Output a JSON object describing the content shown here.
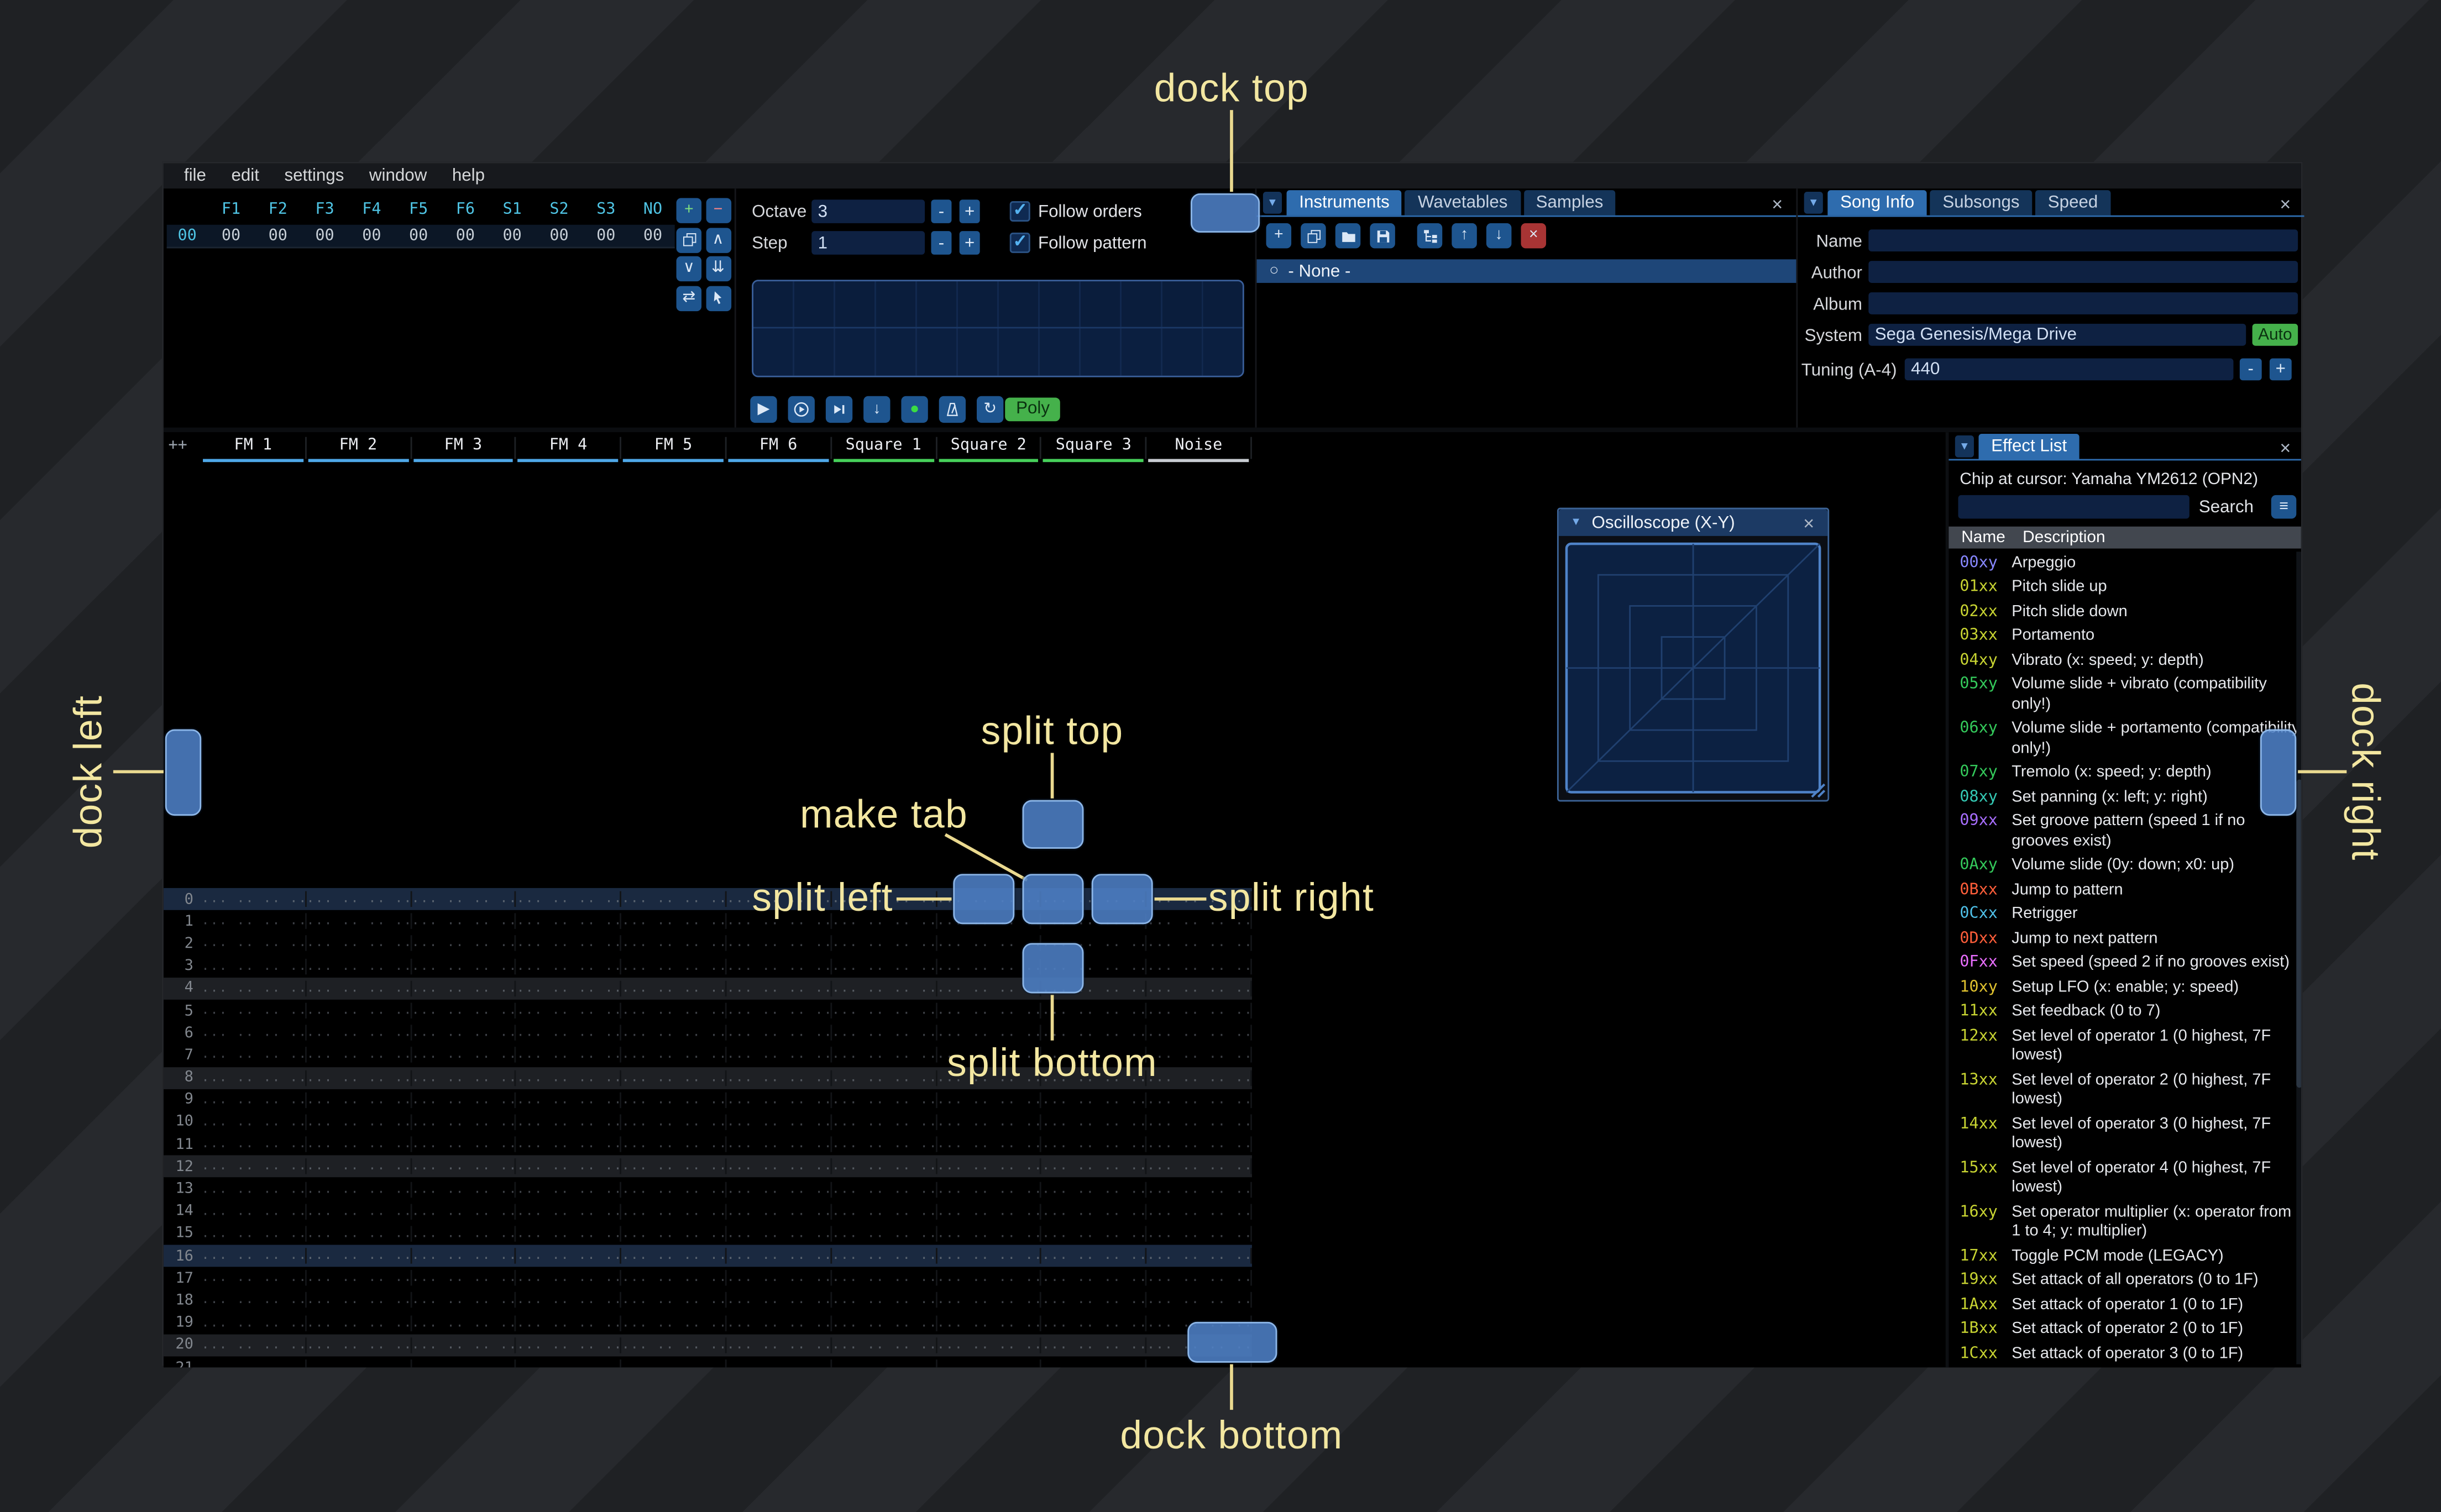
{
  "window": {
    "menu_items": [
      "file",
      "edit",
      "settings",
      "window",
      "help"
    ]
  },
  "orders": {
    "row_index": "00",
    "channel_headers": [
      "F1",
      "F2",
      "F3",
      "F4",
      "F5",
      "F6",
      "S1",
      "S2",
      "S3",
      "NO"
    ],
    "cells": [
      "00",
      "00",
      "00",
      "00",
      "00",
      "00",
      "00",
      "00",
      "00",
      "00"
    ],
    "buttons": [
      {
        "name": "add-order-button",
        "icon": "plus",
        "color": "#7fe07f"
      },
      {
        "name": "remove-order-button",
        "icon": "minus",
        "color": "#ff8585"
      },
      {
        "name": "duplicate-order-button",
        "icon": "duplicate"
      },
      {
        "name": "move-order-up-button",
        "icon": "chevron-up"
      },
      {
        "name": "move-order-down-button",
        "icon": "chevron-down"
      },
      {
        "name": "order-add-at-end-button",
        "icon": "chevrons-down"
      },
      {
        "name": "order-change-mode-button",
        "icon": "swap"
      },
      {
        "name": "order-edit-mode-button",
        "icon": "pointer"
      }
    ]
  },
  "controls": {
    "octave": {
      "label": "Octave",
      "value": "3"
    },
    "step": {
      "label": "Step",
      "value": "1"
    },
    "spin_minus": "-",
    "spin_plus": "+",
    "follow_orders": {
      "label": "Follow orders",
      "checked": true
    },
    "follow_pattern": {
      "label": "Follow pattern",
      "checked": true
    },
    "transport": [
      {
        "name": "play-button",
        "icon": "play"
      },
      {
        "name": "play-pattern-button",
        "icon": "play-pattern"
      },
      {
        "name": "play-from-cursor-button",
        "icon": "play-row"
      },
      {
        "name": "step-one-row-button",
        "icon": "step-down"
      },
      {
        "name": "record-button",
        "icon": "record",
        "color": "#3bdc43"
      },
      {
        "name": "metronome-button",
        "icon": "metronome"
      },
      {
        "name": "repeat-pattern-button",
        "icon": "repeat"
      }
    ],
    "poly_label": "Poly"
  },
  "instruments": {
    "tabs": [
      {
        "label": "Instruments",
        "selected": true
      },
      {
        "label": "Wavetables",
        "selected": false
      },
      {
        "label": "Samples",
        "selected": false
      }
    ],
    "toolbar": [
      {
        "name": "add-instrument-button",
        "icon": "plus"
      },
      {
        "name": "duplicate-instrument-button",
        "icon": "duplicate"
      },
      {
        "name": "open-instrument-button",
        "icon": "folder-open"
      },
      {
        "name": "save-instrument-button",
        "icon": "save"
      },
      {
        "name": "instrument-folder-view-button",
        "icon": "tree",
        "gap": true
      },
      {
        "name": "move-instrument-up-button",
        "icon": "arrow-up"
      },
      {
        "name": "move-instrument-down-button",
        "icon": "arrow-down"
      },
      {
        "name": "delete-instrument-button",
        "icon": "close",
        "bg": "#a83434"
      }
    ],
    "list": [
      {
        "label": "- None -",
        "selected": true
      }
    ]
  },
  "song_info": {
    "tabs": [
      {
        "label": "Song Info",
        "selected": true
      },
      {
        "label": "Subsongs",
        "selected": false
      },
      {
        "label": "Speed",
        "selected": false
      }
    ],
    "fields": [
      {
        "label": "Name",
        "value": ""
      },
      {
        "label": "Author",
        "value": ""
      },
      {
        "label": "Album",
        "value": ""
      }
    ],
    "system": {
      "label": "System",
      "value": "Sega Genesis/Mega Drive",
      "auto_label": "Auto"
    },
    "tuning": {
      "label": "Tuning (A-4)",
      "value": "440",
      "minus": "-",
      "plus": "+"
    }
  },
  "pattern": {
    "corner_label": "++",
    "channels": [
      {
        "name": "FM 1",
        "color": "#4fa8e8"
      },
      {
        "name": "FM 2",
        "color": "#4fa8e8"
      },
      {
        "name": "FM 3",
        "color": "#4fa8e8"
      },
      {
        "name": "FM 4",
        "color": "#4fa8e8"
      },
      {
        "name": "FM 5",
        "color": "#4fa8e8"
      },
      {
        "name": "FM 6",
        "color": "#4fa8e8"
      },
      {
        "name": "Square 1",
        "color": "#46d05a"
      },
      {
        "name": "Square 2",
        "color": "#46d05a"
      },
      {
        "name": "Square 3",
        "color": "#46d05a"
      },
      {
        "name": "Noise",
        "color": "#c8ccd2"
      }
    ],
    "row_count": 22,
    "empty_cell": "... .. .. ...."
  },
  "effect_list": {
    "tab": "Effect List",
    "chip_line": "Chip at cursor: Yamaha YM2612 (OPN2)",
    "search_label": "Search",
    "header_name": "Name",
    "header_desc": "Description",
    "effects": [
      {
        "code": "00xy",
        "desc": "Arpeggio",
        "color": "#8787ff"
      },
      {
        "code": "01xx",
        "desc": "Pitch slide up",
        "color": "#c8d432"
      },
      {
        "code": "02xx",
        "desc": "Pitch slide down",
        "color": "#c8d432"
      },
      {
        "code": "03xx",
        "desc": "Portamento",
        "color": "#c8d432"
      },
      {
        "code": "04xy",
        "desc": "Vibrato (x: speed; y: depth)",
        "color": "#c8d432"
      },
      {
        "code": "05xy",
        "desc": "Volume slide + vibrato (compatibility only!)",
        "color": "#34c95b"
      },
      {
        "code": "06xy",
        "desc": "Volume slide + portamento (compatibility only!)",
        "color": "#34c95b"
      },
      {
        "code": "07xy",
        "desc": "Tremolo (x: speed; y: depth)",
        "color": "#34c95b"
      },
      {
        "code": "08xy",
        "desc": "Set panning (x: left; y: right)",
        "color": "#34c9b4"
      },
      {
        "code": "09xx",
        "desc": "Set groove pattern (speed 1 if no grooves exist)",
        "color": "#a86eff"
      },
      {
        "code": "0Axy",
        "desc": "Volume slide (0y: down; x0: up)",
        "color": "#34c95b"
      },
      {
        "code": "0Bxx",
        "desc": "Jump to pattern",
        "color": "#ff5e3a"
      },
      {
        "code": "0Cxx",
        "desc": "Retrigger",
        "color": "#4fc0e8"
      },
      {
        "code": "0Dxx",
        "desc": "Jump to next pattern",
        "color": "#ff5e3a"
      },
      {
        "code": "0Fxx",
        "desc": "Set speed (speed 2 if no grooves exist)",
        "color": "#e96eff"
      },
      {
        "code": "10xy",
        "desc": "Setup LFO (x: enable; y: speed)",
        "color": "#e0c22f"
      },
      {
        "code": "11xx",
        "desc": "Set feedback (0 to 7)",
        "color": "#c8d432"
      },
      {
        "code": "12xx",
        "desc": "Set level of operator 1 (0 highest, 7F lowest)",
        "color": "#c8d432"
      },
      {
        "code": "13xx",
        "desc": "Set level of operator 2 (0 highest, 7F lowest)",
        "color": "#c8d432"
      },
      {
        "code": "14xx",
        "desc": "Set level of operator 3 (0 highest, 7F lowest)",
        "color": "#c8d432"
      },
      {
        "code": "15xx",
        "desc": "Set level of operator 4 (0 highest, 7F lowest)",
        "color": "#c8d432"
      },
      {
        "code": "16xy",
        "desc": "Set operator multiplier (x: operator from 1 to 4; y: multiplier)",
        "color": "#c8d432"
      },
      {
        "code": "17xx",
        "desc": "Toggle PCM mode (LEGACY)",
        "color": "#c8d432"
      },
      {
        "code": "19xx",
        "desc": "Set attack of all operators (0 to 1F)",
        "color": "#c8d432"
      },
      {
        "code": "1Axx",
        "desc": "Set attack of operator 1 (0 to 1F)",
        "color": "#c8d432"
      },
      {
        "code": "1Bxx",
        "desc": "Set attack of operator 2 (0 to 1F)",
        "color": "#c8d432"
      },
      {
        "code": "1Cxx",
        "desc": "Set attack of operator 3 (0 to 1F)",
        "color": "#c8d432"
      }
    ]
  },
  "oscilloscope": {
    "title": "Oscilloscope (X-Y)"
  },
  "overlay": {
    "accent": "#f3e7a1",
    "labels": {
      "dock_top": "dock top",
      "dock_left": "dock left",
      "dock_right": "dock right",
      "dock_bottom": "dock bottom",
      "split_top": "split top",
      "split_left": "split left",
      "split_right": "split right",
      "split_bottom": "split bottom",
      "make_tab": "make tab"
    }
  }
}
